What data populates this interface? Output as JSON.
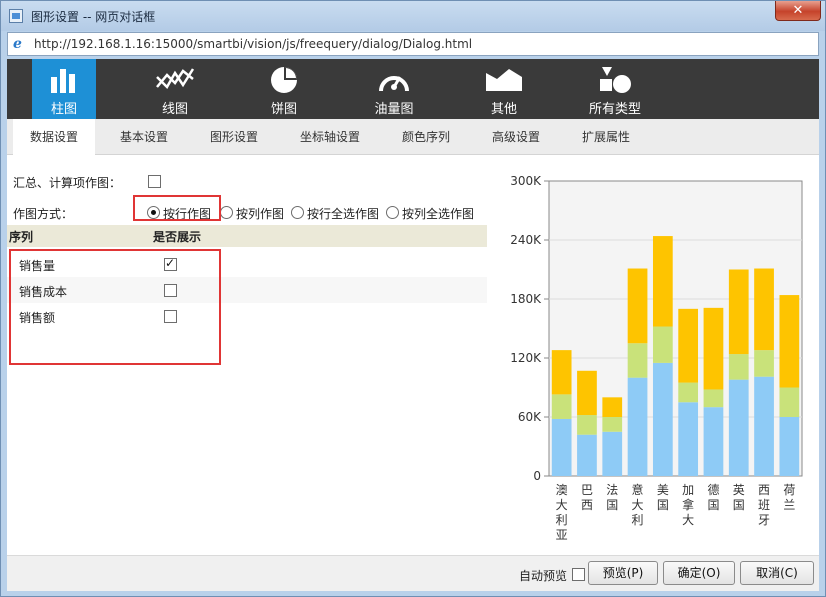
{
  "window": {
    "title": "图形设置 -- 网页对话框",
    "close_label": "✕",
    "url": "http://192.168.1.16:15000/smartbi/vision/js/freequery/dialog/Dialog.html"
  },
  "chart_types": [
    {
      "label": "柱图",
      "icon": "bar-chart-icon",
      "active": true
    },
    {
      "label": "线图",
      "icon": "line-chart-icon",
      "active": false
    },
    {
      "label": "饼图",
      "icon": "pie-chart-icon",
      "active": false
    },
    {
      "label": "油量图",
      "icon": "gauge-icon",
      "active": false
    },
    {
      "label": "其他",
      "icon": "area-chart-icon",
      "active": false
    },
    {
      "label": "所有类型",
      "icon": "shapes-icon",
      "active": false
    }
  ],
  "tabs": [
    {
      "label": "数据设置",
      "active": true
    },
    {
      "label": "基本设置"
    },
    {
      "label": "图形设置"
    },
    {
      "label": "坐标轴设置"
    },
    {
      "label": "颜色序列"
    },
    {
      "label": "高级设置"
    },
    {
      "label": "扩展属性"
    }
  ],
  "form": {
    "summary_label": "汇总、计算项作图：",
    "summary_checked": false,
    "plot_mode_label": "作图方式：",
    "plot_modes": [
      {
        "label": "按行作图",
        "checked": true
      },
      {
        "label": "按列作图",
        "checked": false
      },
      {
        "label": "按行全选作图",
        "checked": false
      },
      {
        "label": "按列全选作图",
        "checked": false
      }
    ],
    "series_header": "序列",
    "show_header": "是否展示",
    "series": [
      {
        "name": "销售量",
        "shown": true
      },
      {
        "name": "销售成本",
        "shown": false
      },
      {
        "name": "销售额",
        "shown": false
      }
    ]
  },
  "footer": {
    "auto_preview_label": "自动预览",
    "auto_preview_checked": false,
    "preview_label": "预览(P)",
    "ok_label": "确定(O)",
    "cancel_label": "取消(C)"
  },
  "chart_data": {
    "type": "bar",
    "stacked": true,
    "categories": [
      "澳大利亚",
      "巴西",
      "法国",
      "意大利",
      "美国",
      "加拿大",
      "德国",
      "英国",
      "西班牙",
      "荷兰"
    ],
    "series": [
      {
        "color": "#8ecbf6",
        "values": [
          58000,
          42000,
          45000,
          100000,
          115000,
          75000,
          70000,
          98000,
          101000,
          60000
        ]
      },
      {
        "color": "#c9e27a",
        "values": [
          25000,
          20000,
          15000,
          35000,
          37000,
          20000,
          18000,
          26000,
          27000,
          30000
        ]
      },
      {
        "color": "#fec400",
        "values": [
          45000,
          45000,
          20000,
          76000,
          92000,
          75000,
          83000,
          86000,
          83000,
          94000
        ]
      }
    ],
    "ylim": [
      0,
      300000
    ],
    "yticks": [
      "0",
      "60K",
      "120K",
      "180K",
      "240K",
      "300K"
    ],
    "grid": true
  }
}
